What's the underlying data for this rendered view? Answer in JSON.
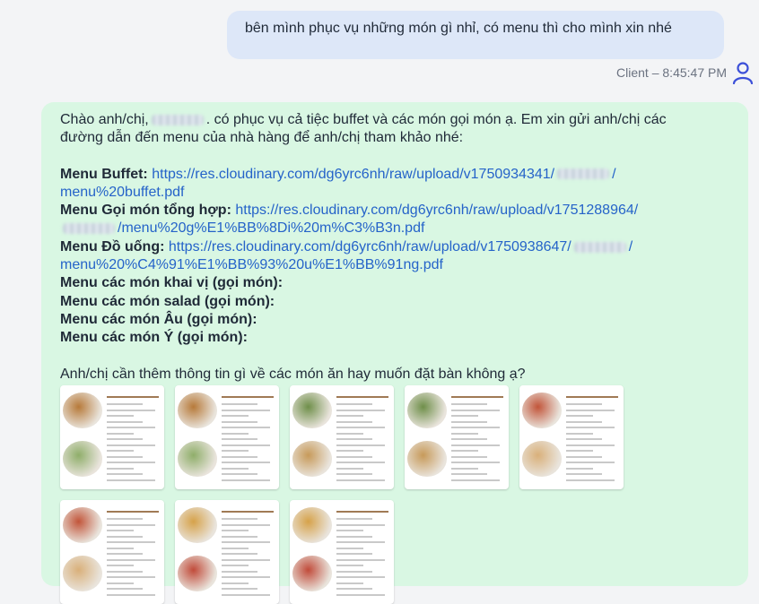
{
  "user_message": {
    "text": "bên mình phục vụ những món gì nhỉ, có menu thì cho mình xin nhé",
    "meta": "Client – 8:45:47 PM",
    "avatar_icon": "user-icon"
  },
  "bot_message": {
    "greeting_before": "Chào anh/chị,",
    "greeting_after": ". có phục vụ cả tiệc buffet và các món gọi món ạ. Em xin gửi anh/chị các",
    "greeting_line2": "đường dẫn đến menu của nhà hàng để anh/chị tham khảo nhé:",
    "menus": [
      {
        "label": "Menu Buffet:",
        "link_line1": "https://res.cloudinary.com/dg6yrc6nh/raw/upload/v1750934341/",
        "link_line1_end": "/",
        "link_line2": "menu%20buffet.pdf"
      },
      {
        "label": "Menu Gọi món tổng hợp:",
        "link_line1": "https://res.cloudinary.com/dg6yrc6nh/raw/upload/v1751288964/",
        "link_line2": "/menu%20g%E1%BB%8Di%20m%C3%B3n.pdf"
      },
      {
        "label": "Menu Đồ uống:",
        "link_line1": "https://res.cloudinary.com/dg6yrc6nh/raw/upload/v1750938647/",
        "link_line1_end": "/",
        "link_line2": "menu%20%C4%91%E1%BB%93%20u%E1%BB%91ng.pdf"
      }
    ],
    "extra_menus": [
      "Menu các món khai vị (gọi món):",
      "Menu các món salad (gọi món):",
      "Menu các món Âu (gọi món):",
      "Menu các món Ý (gọi món):"
    ],
    "closing": "Anh/chị cần thêm thông tin gì về các món ăn hay muốn đặt bàn không ạ?"
  },
  "colors": {
    "user_bubble": "#dde7f8",
    "bot_bubble": "#d9f7e3",
    "link": "#2563c9",
    "avatar": "#3b4fd8"
  },
  "thumbnails": [
    {
      "name": "menu-page-1",
      "photo_colors": [
        "#b77a3a",
        "#8fae6a"
      ]
    },
    {
      "name": "menu-page-2",
      "photo_colors": [
        "#b77a3a",
        "#8fae6a"
      ]
    },
    {
      "name": "menu-page-3",
      "photo_colors": [
        "#6f8f4a",
        "#c79a5a"
      ]
    },
    {
      "name": "menu-page-4",
      "photo_colors": [
        "#6f8f4a",
        "#c79a5a"
      ]
    },
    {
      "name": "menu-page-5",
      "photo_colors": [
        "#c2553a",
        "#d9b07a"
      ]
    },
    {
      "name": "menu-page-6",
      "photo_colors": [
        "#c2553a",
        "#d9b07a"
      ]
    },
    {
      "name": "menu-page-7",
      "photo_colors": [
        "#d6a24a",
        "#c14b3a"
      ]
    },
    {
      "name": "menu-page-8",
      "photo_colors": [
        "#d6a24a",
        "#c14b3a"
      ]
    }
  ]
}
